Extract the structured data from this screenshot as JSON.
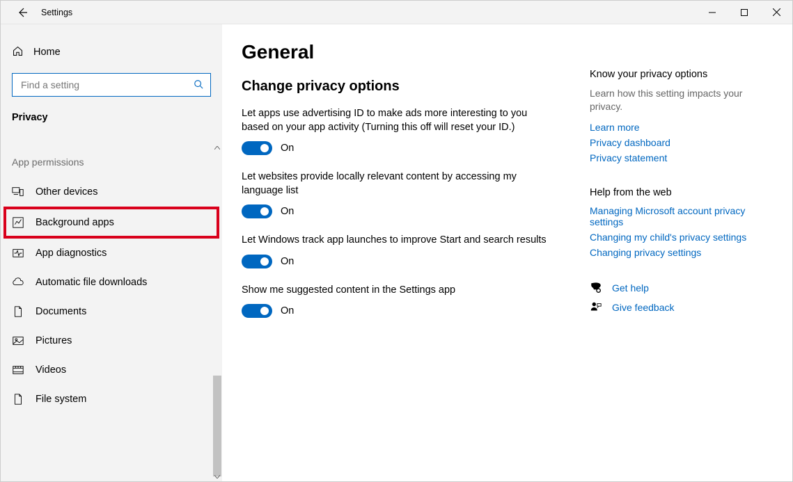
{
  "window": {
    "title": "Settings"
  },
  "sidebar": {
    "home": "Home",
    "search_placeholder": "Find a setting",
    "category": "Privacy",
    "section_header": "App permissions",
    "items": [
      {
        "label": "Other devices"
      },
      {
        "label": "Background apps"
      },
      {
        "label": "App diagnostics"
      },
      {
        "label": "Automatic file downloads"
      },
      {
        "label": "Documents"
      },
      {
        "label": "Pictures"
      },
      {
        "label": "Videos"
      },
      {
        "label": "File system"
      }
    ]
  },
  "main": {
    "title": "General",
    "section": "Change privacy options",
    "settings": [
      {
        "desc": "Let apps use advertising ID to make ads more interesting to you based on your app activity (Turning this off will reset your ID.)",
        "state": "On"
      },
      {
        "desc": "Let websites provide locally relevant content by accessing my language list",
        "state": "On"
      },
      {
        "desc": "Let Windows track app launches to improve Start and search results",
        "state": "On"
      },
      {
        "desc": "Show me suggested content in the Settings app",
        "state": "On"
      }
    ]
  },
  "right": {
    "know_header": "Know your privacy options",
    "know_text": "Learn how this setting impacts your privacy.",
    "know_links": [
      "Learn more",
      "Privacy dashboard",
      "Privacy statement"
    ],
    "help_header": "Help from the web",
    "help_links": [
      "Managing Microsoft account privacy settings",
      "Changing my child's privacy settings",
      "Changing privacy settings"
    ],
    "get_help": "Get help",
    "feedback": "Give feedback"
  }
}
